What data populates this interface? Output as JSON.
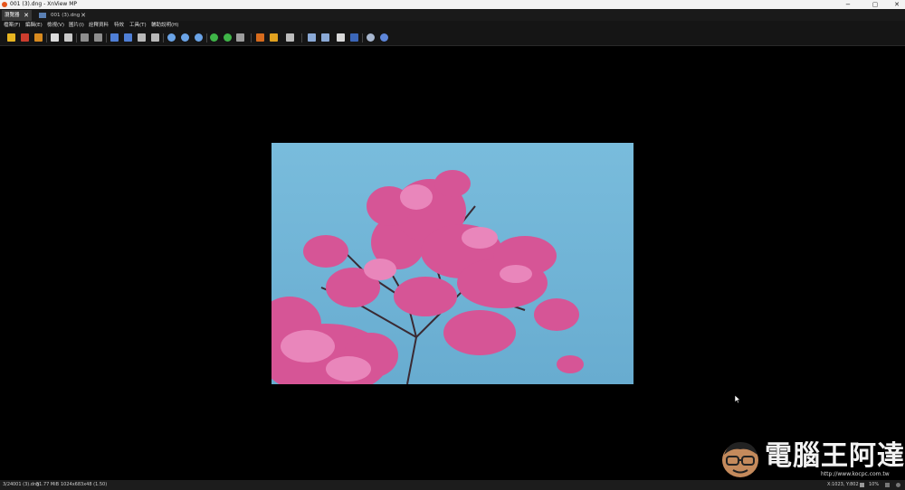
{
  "window": {
    "title": "001 (3).dng - XnView MP",
    "controls": {
      "minimize": "−",
      "maximize": "▢",
      "close": "✕"
    }
  },
  "tabs": [
    {
      "label": "瀏覽器",
      "close": "✕",
      "active": true
    },
    {
      "label": "001 (3).dng",
      "close": "✕",
      "active": false
    }
  ],
  "menu": [
    "檔案(F)",
    "編輯(E)",
    "檢視(V)",
    "圖片(I)",
    "詮釋資料",
    "特效",
    "工具(T)",
    "輔助說明(H)"
  ],
  "toolbar": {
    "icons": [
      "browser-icon",
      "fullscreen-icon",
      "slideshow-icon",
      "save-icon",
      "print-icon",
      "undo-icon",
      "redo-icon",
      "previous-icon",
      "next-icon",
      "fit-icon",
      "actual-size-icon",
      "zoom-in-icon",
      "zoom-out-icon",
      "zoom-fit-icon",
      "rotate-left-icon",
      "rotate-right-icon",
      "crop-icon",
      "adjust-icon",
      "filter-icon",
      "compare-icon",
      "open-with-icon",
      "edit-icon",
      "print-preview-icon",
      "display-icon",
      "settings-icon",
      "help-icon"
    ]
  },
  "viewer": {
    "image": {
      "subject": "pink-blossom-tree",
      "sky_color": "#6fb4d6",
      "blossom_color": "#d9549a"
    }
  },
  "watermark": {
    "text": "電腦王阿達",
    "url": "http://www.kocpc.com.tw"
  },
  "status": {
    "index": "3/24",
    "filename": "001 (3).dng",
    "filesize": "51.77 MiB",
    "dimensions": "1024x683x48 (1.50)",
    "coords": "X:1023, Y:802",
    "zoom": "10%"
  },
  "colors": {
    "titlebar": "#f3f3f3",
    "chrome": "#151515",
    "accent": "#e5541a"
  }
}
